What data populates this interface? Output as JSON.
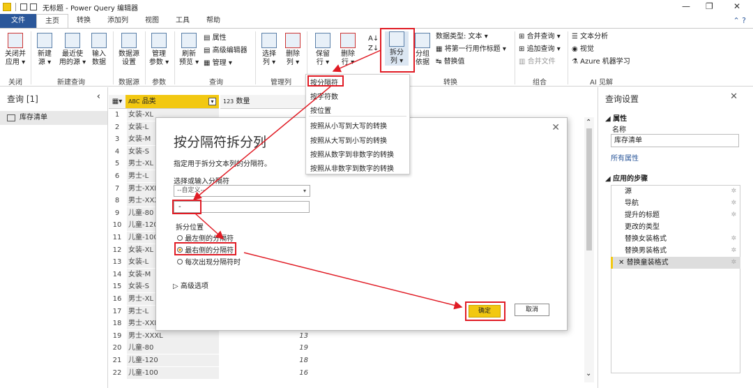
{
  "window": {
    "title": "无标题 - Power Query 编辑器"
  },
  "tabs": [
    "文件",
    "主页",
    "转换",
    "添加列",
    "视图",
    "工具",
    "帮助"
  ],
  "ribbon": {
    "close": "关闭并\n应用 ▾",
    "new_source": "新建\n源 ▾",
    "recent": "最近使\n用的源 ▾",
    "enter_data": "输入\n数据",
    "ds_settings": "数据源\n设置",
    "manage_params": "管理\n参数 ▾",
    "refresh": "刷新\n预览 ▾",
    "properties": "属性",
    "advanced_editor": "高级编辑器",
    "manage": "管理 ▾",
    "choose_cols": "选择\n列 ▾",
    "remove_cols": "删除\n列 ▾",
    "keep_rows": "保留\n行 ▾",
    "remove_rows": "删除\n行 ▾",
    "split_col": "拆分\n列 ▾",
    "group_by": "分组\n依据",
    "datatype": "数据类型: 文本 ▾",
    "first_row_header": "将第一行用作标题 ▾",
    "replace_values": "替换值",
    "merge_queries": "合并查询 ▾",
    "append_queries": "追加查询 ▾",
    "combine_files": "合并文件",
    "text_analytics": "文本分析",
    "vision": "视觉",
    "azure_ml": "Azure 机器学习",
    "groups": [
      "关闭",
      "新建查询",
      "数据源",
      "参数",
      "查询",
      "管理列",
      "减少行",
      "排序",
      "转换",
      "组合",
      "AI 见解"
    ]
  },
  "left": {
    "header": "查询 [1]",
    "query": "库存清单"
  },
  "grid": {
    "col1": "品类",
    "col2": "数量",
    "col1_type": "ABC",
    "col2_type": "123",
    "rows": [
      {
        "n": "1",
        "c": "女装-XL",
        "v": ""
      },
      {
        "n": "2",
        "c": "女装-L",
        "v": ""
      },
      {
        "n": "3",
        "c": "女装-M",
        "v": ""
      },
      {
        "n": "4",
        "c": "女装-S",
        "v": ""
      },
      {
        "n": "5",
        "c": "男士-XL",
        "v": ""
      },
      {
        "n": "6",
        "c": "男士-L",
        "v": ""
      },
      {
        "n": "7",
        "c": "男士-XXL",
        "v": ""
      },
      {
        "n": "8",
        "c": "男士-XXXL",
        "v": ""
      },
      {
        "n": "9",
        "c": "儿童-80",
        "v": ""
      },
      {
        "n": "10",
        "c": "儿童-120",
        "v": ""
      },
      {
        "n": "11",
        "c": "儿童-100",
        "v": ""
      },
      {
        "n": "12",
        "c": "女装-XL",
        "v": ""
      },
      {
        "n": "13",
        "c": "女装-L",
        "v": ""
      },
      {
        "n": "14",
        "c": "女装-M",
        "v": ""
      },
      {
        "n": "15",
        "c": "女装-S",
        "v": ""
      },
      {
        "n": "16",
        "c": "男士-XL",
        "v": ""
      },
      {
        "n": "17",
        "c": "男士-L",
        "v": ""
      },
      {
        "n": "18",
        "c": "男士-XXL",
        "v": ""
      },
      {
        "n": "19",
        "c": "男士-XXXL",
        "v": "13"
      },
      {
        "n": "20",
        "c": "儿童-80",
        "v": "19"
      },
      {
        "n": "21",
        "c": "儿童-120",
        "v": "18"
      },
      {
        "n": "22",
        "c": "儿童-100",
        "v": "16"
      }
    ]
  },
  "menu": [
    "按分隔符",
    "按字符数",
    "按位置",
    "按照从小写到大写的转换",
    "按照从大写到小写的转换",
    "按照从数字到非数字的转换",
    "按照从非数字到数字的转换"
  ],
  "dialog": {
    "title": "按分隔符拆分列",
    "desc": "指定用于拆分文本列的分隔符。",
    "select_label": "选择或输入分隔符",
    "select_value": "--自定义--",
    "custom_value": "-",
    "position_label": "拆分位置",
    "opt_left": "最左侧的分隔符",
    "opt_right": "最右侧的分隔符",
    "opt_each": "每次出现分隔符时",
    "advanced": "高级选项",
    "ok": "确定",
    "cancel": "取消"
  },
  "right": {
    "title": "查询设置",
    "props": "属性",
    "name_label": "名称",
    "name_value": "库存清单",
    "all_props": "所有属性",
    "steps_title": "应用的步骤",
    "steps": [
      "源",
      "导航",
      "提升的标题",
      "更改的类型",
      "替换女装格式",
      "替换男装格式",
      "替换童装格式"
    ]
  },
  "colors": {
    "accent": "#2b579a",
    "highlight": "#e01b24",
    "ok_button": "#f2c811"
  }
}
